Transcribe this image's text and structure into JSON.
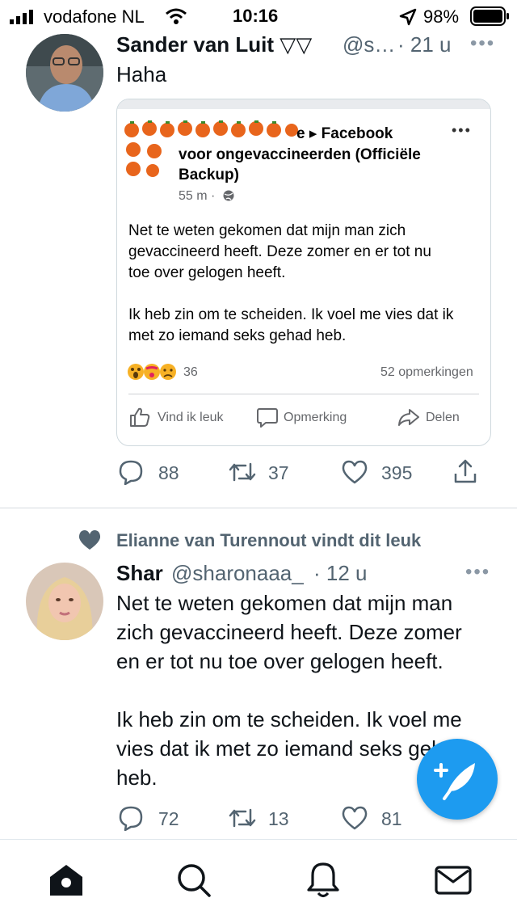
{
  "status_bar": {
    "carrier": "vodafone NL",
    "time": "10:16",
    "battery": "98%"
  },
  "tweet1": {
    "name": "Sander van Luit ▽▽",
    "handle": "@s…",
    "time": "· 21 u",
    "text": "Haha",
    "embedded": {
      "title_suffix": "e ▸ Facebook",
      "title_line2": "voor ongevaccineerden (Officiële",
      "title_line3": "Backup)",
      "meta": "55 m ·",
      "text": "Net te weten gekomen dat mijn man zich\ngevaccineerd heeft. Deze zomer en er tot nu\ntoe over gelogen heeft.\n\nIk heb zin om te scheiden. Ik voel me vies dat ik\nmet zo iemand seks gehad heb.",
      "reaction_count": "36",
      "comments": "52 opmerkingen",
      "like_label": "Vind ik leuk",
      "comment_label": "Opmerking",
      "share_label": "Delen"
    },
    "replies": "88",
    "retweets": "37",
    "likes": "395"
  },
  "social_context": "Elianne van Turennout vindt dit leuk",
  "tweet2": {
    "name": "Shar",
    "handle": "@sharonaaa_",
    "time": "· 12 u",
    "text": "Net te weten gekomen dat mijn man\nzich gevaccineerd heeft. Deze zomer\nen er tot nu toe over gelogen heeft.\n\nIk heb zin om te scheiden. Ik voel me\nvies dat ik met zo iemand seks gehad\nheb.",
    "replies": "72",
    "retweets": "13",
    "likes": "81"
  },
  "colors": {
    "accent": "#1d9bf0",
    "muted": "#536471",
    "divider": "#d6dbe0"
  }
}
